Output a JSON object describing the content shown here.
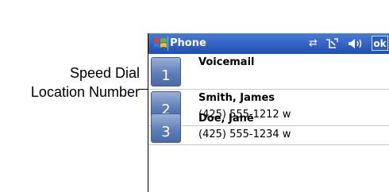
{
  "callout": {
    "line1": "Speed Dial",
    "line2": "Location Number"
  },
  "titlebar": {
    "title": "Phone",
    "icons": [
      "connectivity-icon",
      "phone-signal-icon",
      "volume-icon"
    ],
    "ok_label": "ok"
  },
  "speed_dial": [
    {
      "location": "1",
      "name": "Voicemail",
      "number": ""
    },
    {
      "location": "2",
      "name": "Smith, James",
      "number": "(425) 555-1212 w"
    },
    {
      "location": "3",
      "name": "Doe, Jane",
      "number": "(425) 555-1234 w"
    }
  ],
  "colors": {
    "titlebar": "#1c4fb4",
    "button": "#5f7fb8"
  }
}
